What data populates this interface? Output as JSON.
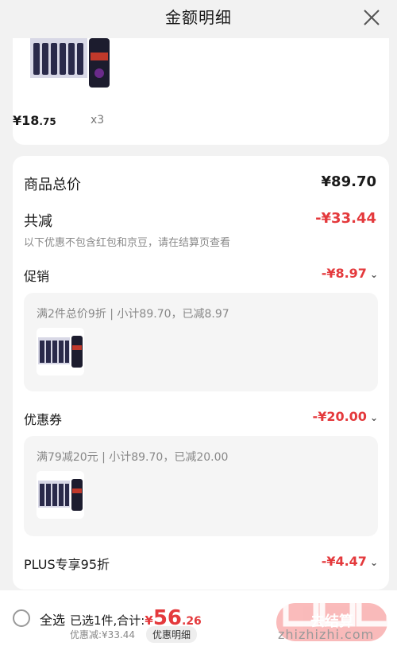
{
  "header": {
    "title": "金额明细"
  },
  "top_item": {
    "price_int": "¥18",
    "price_dec": ".75",
    "qty": "x3"
  },
  "summary": {
    "goods_total_label": "商品总价",
    "goods_total_value": "¥89.70",
    "reduce_label": "共减",
    "reduce_value": "-¥33.44",
    "note": "以下优惠不包含红包和京豆，请在结算页查看"
  },
  "promo": {
    "label": "促销",
    "value": "-¥8.97",
    "detail": "满2件总价9折 | 小计89.70，已减8.97"
  },
  "coupon": {
    "label": "优惠券",
    "value": "-¥20.00",
    "detail": "满79减20元 | 小计89.70，已减20.00"
  },
  "plus": {
    "label": "PLUS专享95折",
    "value": "-¥4.47"
  },
  "bottom": {
    "select_all": "全选",
    "selected_prefix": "已选1件,合计:",
    "total_symbol": "¥",
    "total_int": "56",
    "total_dec": ".26",
    "discount_text": "优惠减:¥33.44",
    "detail_button": "优惠明细",
    "checkout": "去结算"
  },
  "watermark": {
    "text": "zhizhizhi.com"
  },
  "colors": {
    "accent_red": "#e4393c",
    "background": "#f2f2f2"
  }
}
